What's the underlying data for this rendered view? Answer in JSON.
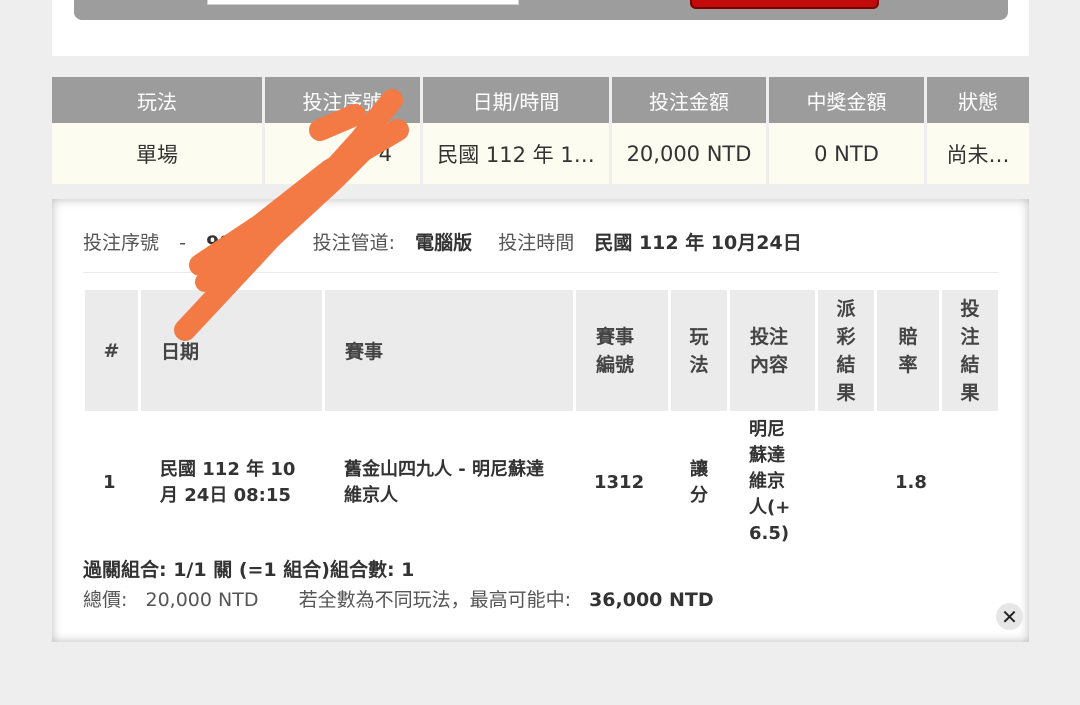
{
  "summary": {
    "headers": [
      "玩法",
      "投注序號",
      "日期/時間",
      "投注金額",
      "中獎金額",
      "狀態"
    ],
    "row": [
      "單場",
      "4",
      "民國 112 年 1…",
      "20,000 NTD",
      "0 NTD",
      "尚未…"
    ]
  },
  "detail": {
    "serial_label": "投注序號",
    "serial_sep": "-",
    "serial_value": "98",
    "channel_label": "投注管道:",
    "channel_value": "電腦版",
    "time_label": "投注時間",
    "time_value": "民國 112 年 10月24日",
    "table": {
      "headers": {
        "num": "#",
        "date": "日期",
        "match": "賽事",
        "match_no": "賽事編號",
        "play": "玩法",
        "bet": "投注內容",
        "payout": "派彩結果",
        "odds": "賠率",
        "result": "投注結果"
      },
      "rows": [
        {
          "num": "1",
          "date": "民國 112 年 10月 24日 08:15",
          "match": "舊金山四九人 - 明尼蘇達維京人",
          "match_no": "1312",
          "play": "讓分",
          "bet": "明尼蘇達維京人(+6.5)",
          "payout": "",
          "odds": "1.8",
          "result": ""
        }
      ]
    },
    "combo": "過關組合: 1/1 關 (=1 組合)組合數: 1",
    "total_label": "總價:",
    "total_value": "20,000 NTD",
    "max_label": "若全數為不同玩法，最高可能中:",
    "max_value": "36,000 NTD",
    "close_glyph": "✕"
  },
  "colors": {
    "header_bg": "#9c9c9c",
    "row_bg": "#fcfcf0",
    "scribble": "#f47a45",
    "top_red": "#c20b0b"
  }
}
